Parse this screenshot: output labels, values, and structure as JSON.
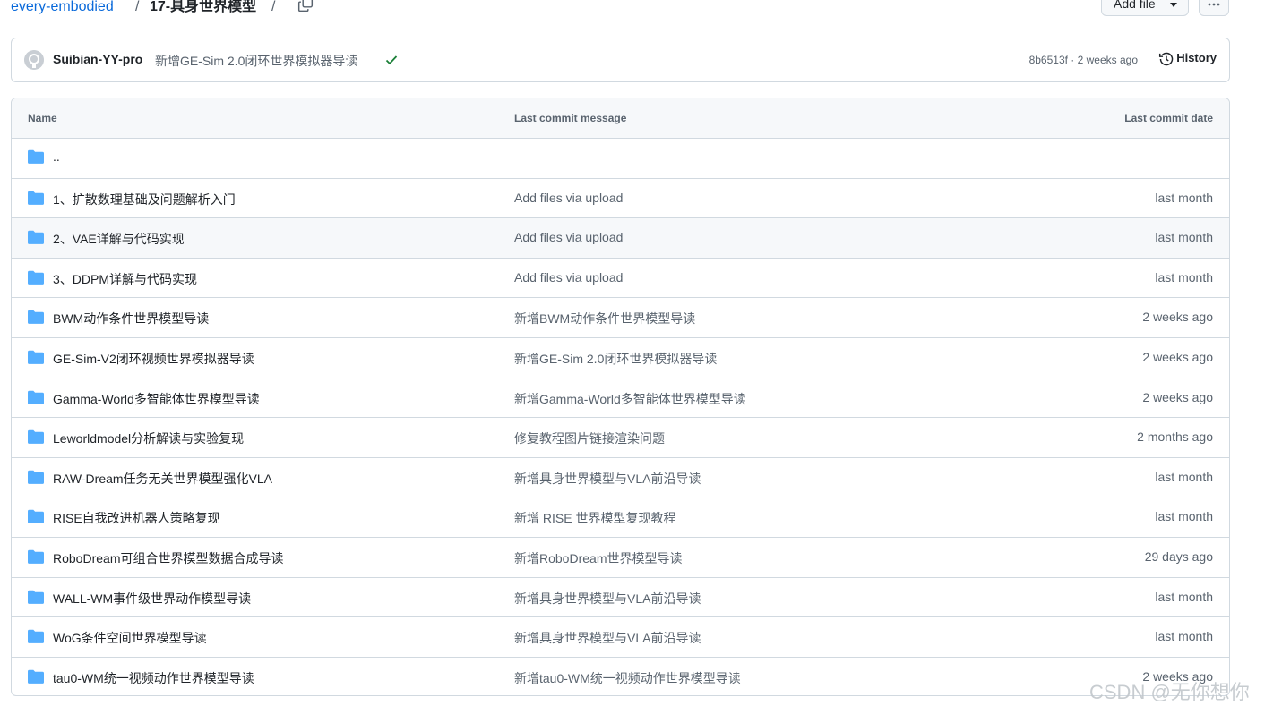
{
  "breadcrumb": {
    "repo": "every-embodied",
    "sep": "/",
    "dir": "17-具身世界模型"
  },
  "toolbar": {
    "add_file_label": "Add file"
  },
  "latest_commit": {
    "author": "Suibian-YY-pro",
    "message": "新增GE-Sim 2.0闭环世界模拟器导读",
    "meta": "8b6513f · 2 weeks ago",
    "history_label": "History"
  },
  "table": {
    "headers": {
      "name": "Name",
      "message": "Last commit message",
      "date": "Last commit date"
    },
    "parent": "..",
    "rows": [
      {
        "name": "1、扩散数理基础及问题解析入门",
        "message": "Add files via upload",
        "date": "last month"
      },
      {
        "name": "2、VAE详解与代码实现",
        "message": "Add files via upload",
        "date": "last month"
      },
      {
        "name": "3、DDPM详解与代码实现",
        "message": "Add files via upload",
        "date": "last month"
      },
      {
        "name": "BWM动作条件世界模型导读",
        "message": "新增BWM动作条件世界模型导读",
        "date": "2 weeks ago"
      },
      {
        "name": "GE-Sim-V2闭环视频世界模拟器导读",
        "message": "新增GE-Sim 2.0闭环世界模拟器导读",
        "date": "2 weeks ago"
      },
      {
        "name": "Gamma-World多智能体世界模型导读",
        "message": "新增Gamma-World多智能体世界模型导读",
        "date": "2 weeks ago"
      },
      {
        "name": "Leworldmodel分析解读与实验复现",
        "message": "修复教程图片链接渲染问题",
        "date": "2 months ago"
      },
      {
        "name": "RAW-Dream任务无关世界模型强化VLA",
        "message": "新增具身世界模型与VLA前沿导读",
        "date": "last month"
      },
      {
        "name": "RISE自我改进机器人策略复现",
        "message": "新增 RISE 世界模型复现教程",
        "date": "last month"
      },
      {
        "name": "RoboDream可组合世界模型数据合成导读",
        "message": "新增RoboDream世界模型导读",
        "date": "29 days ago"
      },
      {
        "name": "WALL-WM事件级世界动作模型导读",
        "message": "新增具身世界模型与VLA前沿导读",
        "date": "last month"
      },
      {
        "name": "WoG条件空间世界模型导读",
        "message": "新增具身世界模型与VLA前沿导读",
        "date": "last month"
      },
      {
        "name": "tau0-WM统一视频动作世界模型导读",
        "message": "新增tau0-WM统一视频动作世界模型导读",
        "date": "2 weeks ago"
      }
    ]
  },
  "watermark": "CSDN @无你想你",
  "colors": {
    "link": "#0969da",
    "folder": "#54aeff",
    "check": "#1a7f37",
    "border": "#d1d9e0",
    "muted": "#59636e"
  }
}
